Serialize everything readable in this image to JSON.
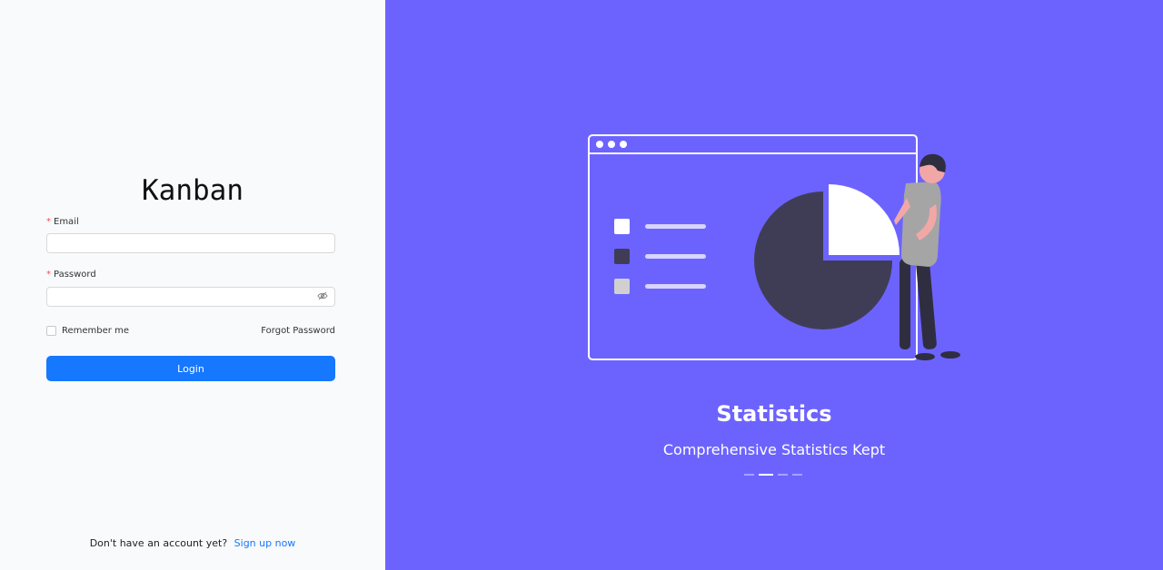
{
  "brand": {
    "name": "Kanban"
  },
  "form": {
    "email_label": "Email",
    "email_value": "",
    "password_label": "Password",
    "password_value": "",
    "remember_label": "Remember me",
    "forgot_label": "Forgot Password",
    "login_label": "Login"
  },
  "footer": {
    "prompt": "Don't have an account yet?",
    "signup_label": "Sign up now"
  },
  "carousel": {
    "title": "Statistics",
    "subtitle": "Comprehensive Statistics Kept",
    "dots": 4,
    "active_index": 1
  },
  "colors": {
    "accent": "#6c63ff",
    "primary": "#1677ff"
  },
  "icons": {
    "password_toggle": "eye-invisible-icon"
  }
}
